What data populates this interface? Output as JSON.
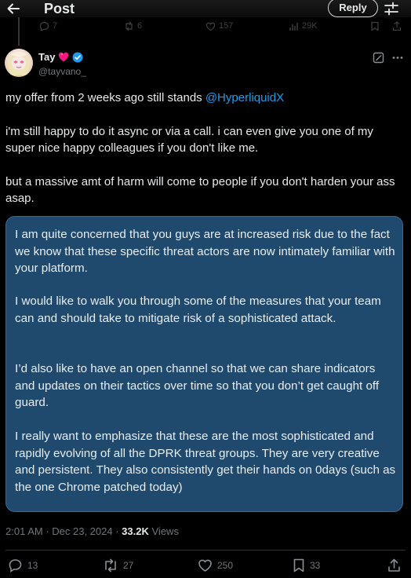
{
  "header": {
    "title": "Post",
    "reply_label": "Reply",
    "back_icon": "arrow-left-icon",
    "filter_icon": "sliders-icon"
  },
  "prev_tweet": {
    "replies": "7",
    "reposts": "6",
    "likes": "157",
    "views": "29K"
  },
  "author": {
    "display_name": "Tay",
    "handle": "@tayvano_",
    "verified_color": "#1d9bf0",
    "heart_color": "#f91880"
  },
  "tweet": {
    "line1_text": "my offer from 2 weeks ago still stands ",
    "line1_mention": "@HyperliquidX",
    "para2": "i'm still happy to do it async or via a call. i can even give you one of my super nice happy colleagues if you don't like me.",
    "para3": "but a massive amt of harm will come to people if you don't harden your ass asap."
  },
  "image_card": {
    "background_color": "#20496e",
    "paragraphs": [
      "I am quite concerned that you guys are at increased risk due to the fact we know that these specific threat actors are now intimately familiar with your platform.",
      "I would like to walk you through some of the measures that your team can and should take to mitigate risk of a sophisticated attack.",
      "I’d also like to have an open channel so that we can share indicators and updates on their tactics over time so that you don’t get caught off guard.",
      "I really want to emphasize that these are the most sophisticated and rapidly evolving of all the DPRK threat groups. They are very creative and persistent. They also consistently get their hands on 0days (such as the one Chrome patched today)"
    ]
  },
  "meta": {
    "time": "2:01 AM",
    "date": "Dec 23, 2024",
    "views_count": "33.2K",
    "views_label": "Views"
  },
  "actions": {
    "replies": "13",
    "reposts": "27",
    "likes": "250",
    "bookmarks": "33"
  }
}
